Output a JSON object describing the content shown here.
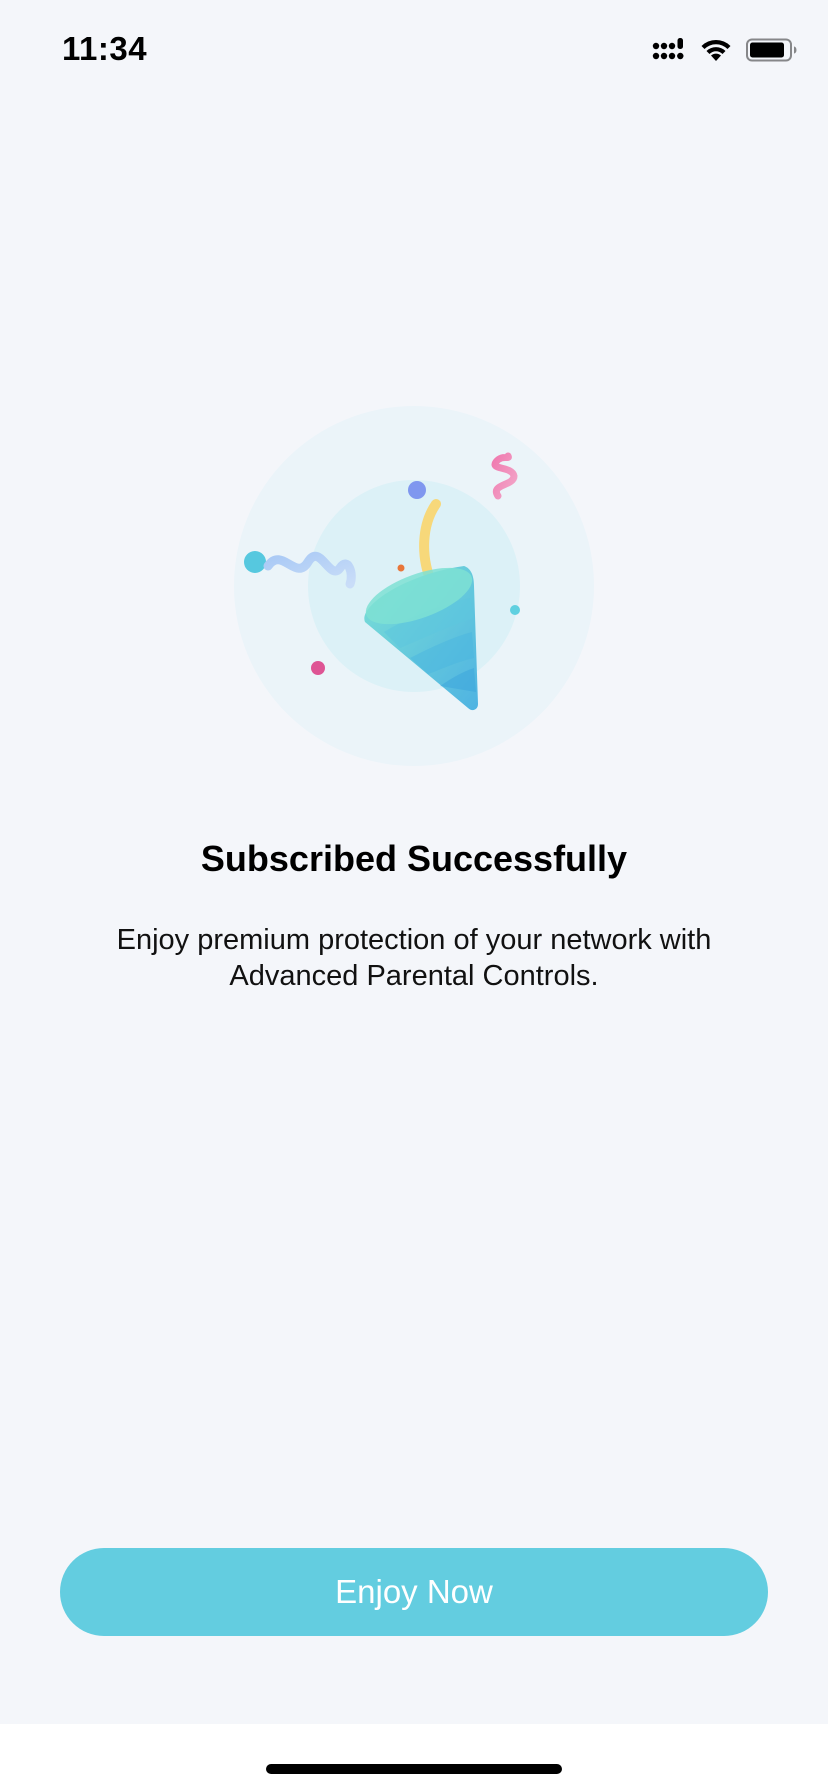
{
  "status_bar": {
    "time": "11:34",
    "icons": [
      "cellular-signal-icon",
      "wifi-icon",
      "battery-icon"
    ]
  },
  "illustration": {
    "name": "party-popper-illustration"
  },
  "main": {
    "title": "Subscribed Successfully",
    "description": "Enjoy premium protection of your network with Advanced Parental Controls."
  },
  "actions": {
    "primary_label": "Enjoy Now"
  },
  "colors": {
    "background": "#f4f6fa",
    "accent": "#63cde0",
    "button_text": "#ffffff"
  }
}
